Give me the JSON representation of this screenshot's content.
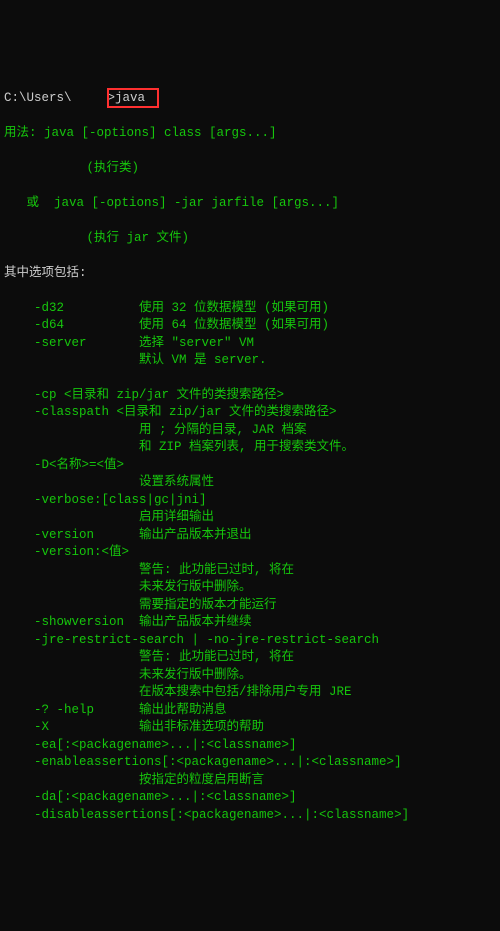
{
  "prompt": {
    "path": "C:\\Users\\",
    "command": "java"
  },
  "usage": {
    "line1": "用法: java [-options] class [args...]",
    "line2": "           (执行类)",
    "line3": "   或  java [-options] -jar jarfile [args...]",
    "line4": "           (执行 jar 文件)"
  },
  "optionsHeader": "其中选项包括:",
  "options": [
    "    -d32          使用 32 位数据模型 (如果可用)",
    "    -d64          使用 64 位数据模型 (如果可用)",
    "    -server       选择 \"server\" VM",
    "                  默认 VM 是 server.",
    "",
    "    -cp <目录和 zip/jar 文件的类搜索路径>",
    "    -classpath <目录和 zip/jar 文件的类搜索路径>",
    "                  用 ; 分隔的目录, JAR 档案",
    "                  和 ZIP 档案列表, 用于搜索类文件。",
    "    -D<名称>=<值>",
    "                  设置系统属性",
    "    -verbose:[class|gc|jni]",
    "                  启用详细输出",
    "    -version      输出产品版本并退出",
    "    -version:<值>",
    "                  警告: 此功能已过时, 将在",
    "                  未来发行版中删除。",
    "                  需要指定的版本才能运行",
    "    -showversion  输出产品版本并继续",
    "    -jre-restrict-search | -no-jre-restrict-search",
    "                  警告: 此功能已过时, 将在",
    "                  未来发行版中删除。",
    "                  在版本搜索中包括/排除用户专用 JRE",
    "    -? -help      输出此帮助消息",
    "    -X            输出非标准选项的帮助",
    "    -ea[:<packagename>...|:<classname>]",
    "    -enableassertions[:<packagename>...|:<classname>]",
    "                  按指定的粒度启用断言",
    "    -da[:<packagename>...|:<classname>]",
    "    -disableassertions[:<packagename>...|:<classname>]"
  ]
}
